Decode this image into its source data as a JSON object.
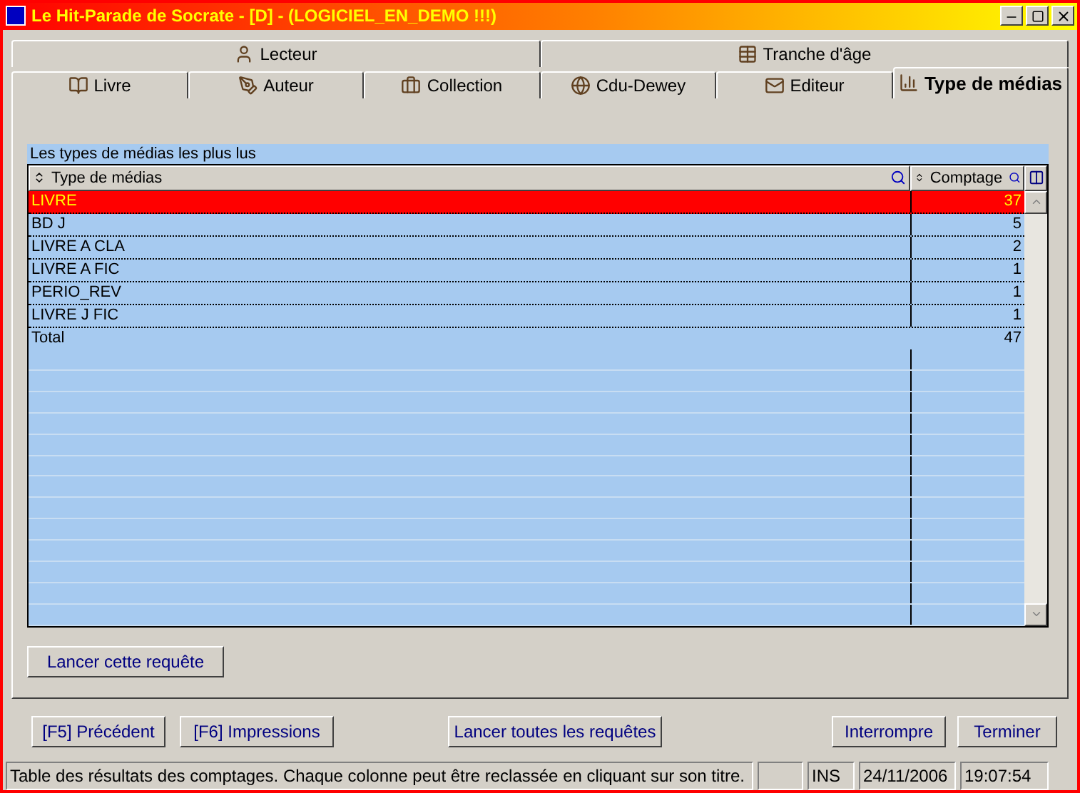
{
  "window": {
    "title": "Le Hit-Parade de Socrate - [D] - (LOGICIEL_EN_DEMO !!!)"
  },
  "tab_rows": [
    [
      {
        "label": "Lecteur",
        "selected": false
      },
      {
        "label": "Tranche d'âge",
        "selected": false
      }
    ],
    [
      {
        "label": "Livre",
        "selected": false
      },
      {
        "label": "Auteur",
        "selected": false
      },
      {
        "label": "Collection",
        "selected": false
      },
      {
        "label": "Cdu-Dewey",
        "selected": false
      },
      {
        "label": "Editeur",
        "selected": false
      },
      {
        "label": "Type de médias",
        "selected": true
      }
    ]
  ],
  "table": {
    "caption": "Les types de médias les plus lus",
    "columns": [
      "Type de médias",
      "Comptage"
    ],
    "rows": [
      {
        "cells": [
          "LIVRE",
          "37"
        ],
        "selected": true
      },
      {
        "cells": [
          "BD J",
          "5"
        ],
        "selected": false
      },
      {
        "cells": [
          "LIVRE A CLA",
          "2"
        ],
        "selected": false
      },
      {
        "cells": [
          "LIVRE A FIC",
          "1"
        ],
        "selected": false
      },
      {
        "cells": [
          "PERIO_REV",
          "1"
        ],
        "selected": false
      },
      {
        "cells": [
          "LIVRE J FIC",
          "1"
        ],
        "selected": false
      }
    ],
    "total": [
      "Total",
      "47"
    ]
  },
  "run_button": "Lancer cette requête",
  "buttons_left": [
    "[F5] Précédent",
    "[F6] Impressions"
  ],
  "button_center": "Lancer toutes les requêtes",
  "buttons_right": [
    "Interrompre",
    "Terminer"
  ],
  "status_bar": {
    "message": "Table des résultats des comptages. Chaque colonne peut être reclassée en cliquant sur son titre.",
    "mode": "INS",
    "date": "24/11/2006",
    "time": "19:07:54"
  }
}
